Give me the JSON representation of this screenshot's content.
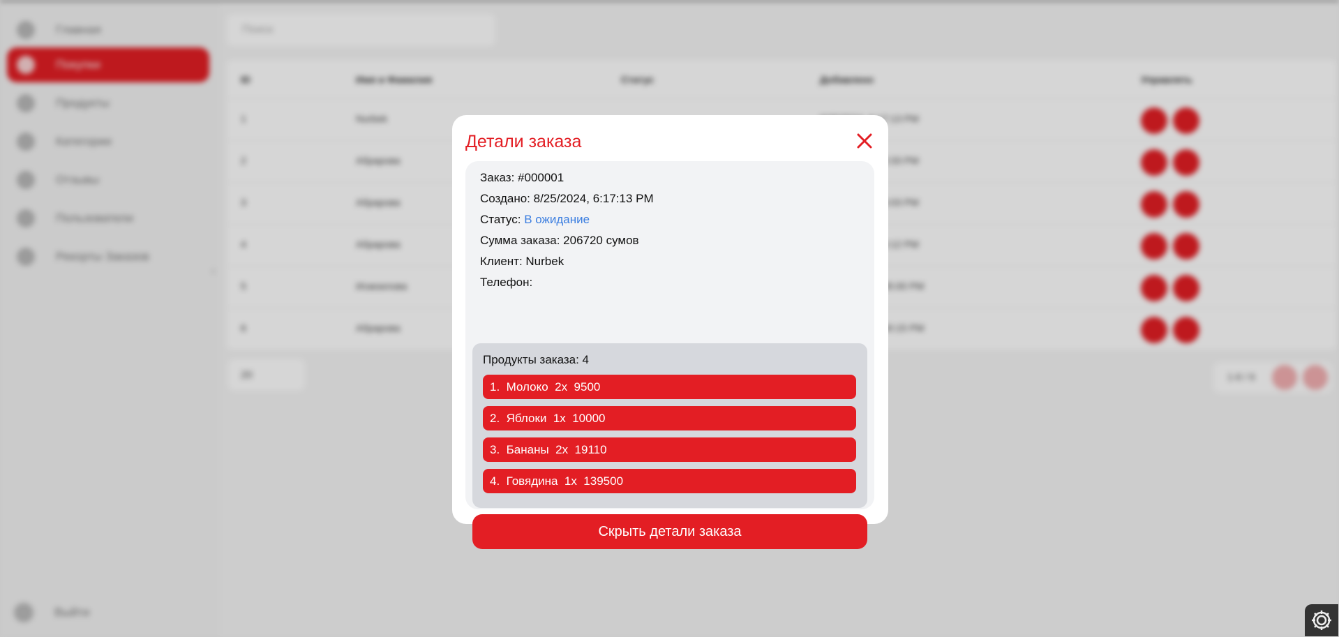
{
  "sidebar": {
    "items": [
      {
        "label": "Главная",
        "icon": "home-icon"
      },
      {
        "label": "Покупки",
        "icon": "shopping-bag-icon",
        "active": true
      },
      {
        "label": "Продукты",
        "icon": "globe-icon"
      },
      {
        "label": "Категории",
        "icon": "shapes-icon"
      },
      {
        "label": "Отзывы",
        "icon": "comment-icon"
      },
      {
        "label": "Пользователи",
        "icon": "user-icon"
      },
      {
        "label": "Рекорты Заказов",
        "icon": "settings-icon"
      }
    ],
    "logout_label": "Выйти"
  },
  "search": {
    "placeholder": "Поиск"
  },
  "table": {
    "headers": [
      "ID",
      "Имя и Фамилия",
      "Статус",
      "Добавлено",
      "Управлять"
    ],
    "rows": [
      {
        "id": "1",
        "name": "Nurbek",
        "date": "8/25/2024, 6:17:13 PM"
      },
      {
        "id": "2",
        "name": "Абрарова",
        "date": "8/25/2024, 7:03:33 PM"
      },
      {
        "id": "3",
        "name": "Абрарова",
        "date": "8/25/2024, 7:05:03 PM"
      },
      {
        "id": "4",
        "name": "Абрарова",
        "date": "8/25/2024, 7:06:12 PM"
      },
      {
        "id": "5",
        "name": "Исмоилова",
        "date": "8/26/2024, 10:35:00 PM"
      },
      {
        "id": "6",
        "name": "Абрарова",
        "date": "8/26/2024, 10:40:15 PM"
      }
    ]
  },
  "pagination": {
    "page_size": "20",
    "range": "1-6 / 6"
  },
  "modal": {
    "title": "Детали заказа",
    "order_line": "Заказ: #000001",
    "created_line": "Создано: 8/25/2024, 6:17:13 PM",
    "status_label": "Статус: ",
    "status_value": "В ожидание",
    "status_color": "#3a7de0",
    "sum_line": "Сумма заказа: 206720 сумов",
    "client_line": "Клиент: Nurbek",
    "phone_line": "Телефон:",
    "products_title": "Продукты заказа: 4",
    "products": [
      "1.  Молоко  2x  9500",
      "2.  Яблоки  1x  10000",
      "3.  Бананы  2x  19110",
      "4.  Говядина  1x  139500"
    ],
    "hide_button": "Скрыть детали заказа"
  },
  "colors": {
    "accent": "#e31e24",
    "panel": "#f2f3f5",
    "products_panel": "#d6d8dd"
  }
}
